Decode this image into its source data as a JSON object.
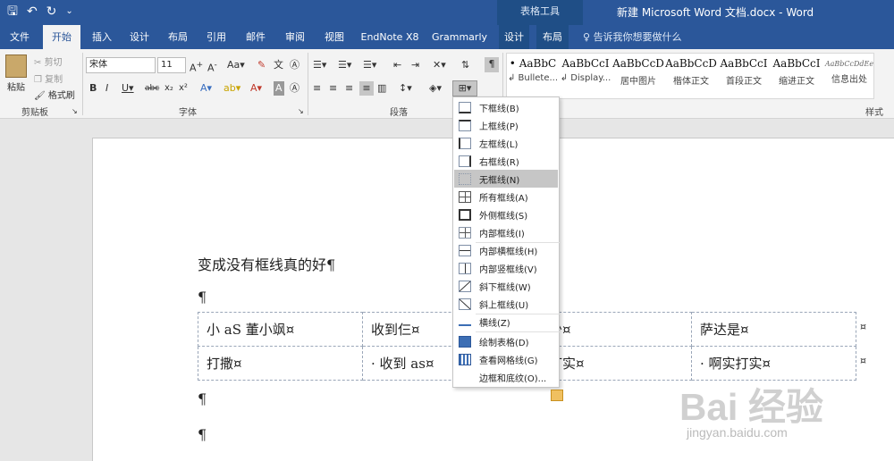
{
  "window": {
    "title": "新建 Microsoft Word 文档.docx - Word",
    "context_tab_group": "表格工具"
  },
  "qat": {
    "save_icon": "save-icon",
    "undo_icon": "undo-icon",
    "redo_icon": "redo-icon",
    "customize_icon": "customize-icon"
  },
  "tabs": [
    {
      "label": "文件"
    },
    {
      "label": "开始"
    },
    {
      "label": "插入"
    },
    {
      "label": "设计"
    },
    {
      "label": "布局"
    },
    {
      "label": "引用"
    },
    {
      "label": "邮件"
    },
    {
      "label": "审阅"
    },
    {
      "label": "视图"
    },
    {
      "label": "EndNote X8"
    },
    {
      "label": "Grammarly"
    },
    {
      "label": "设计"
    },
    {
      "label": "布局"
    }
  ],
  "tellme": "告诉我你想要做什么",
  "ribbon": {
    "clipboard": {
      "paste": "粘贴",
      "cut": "剪切",
      "copy": "复制",
      "format_painter": "格式刷",
      "label": "剪贴板"
    },
    "font": {
      "name": "宋体",
      "size": "11",
      "label": "字体"
    },
    "paragraph": {
      "label": "段落"
    },
    "styles": {
      "label": "样式",
      "items": [
        {
          "sample": "• AaBbC",
          "name": "↲ Bullete..."
        },
        {
          "sample": "AaBbCcI",
          "name": "↲ Display..."
        },
        {
          "sample": "AaBbCcD",
          "name": "居中图片"
        },
        {
          "sample": "AaBbCcD",
          "name": "楷体正文"
        },
        {
          "sample": "AaBbCcI",
          "name": "首段正文"
        },
        {
          "sample": "AaBbCcI",
          "name": "缩进正文"
        },
        {
          "sample": "AaBbCcDdEe",
          "name": "信息出处"
        }
      ]
    }
  },
  "document": {
    "heading": "变成没有框线真的好¶",
    "pilcrow": "¶",
    "table": [
      [
        "小 aS 董小飒¤",
        "收到仨¤",
        "多少¤",
        "萨达是¤"
      ],
      [
        "打撒¤",
        "· 收到 as¤",
        "实打实¤",
        "· 啊实打实¤"
      ]
    ],
    "row_end": "¤"
  },
  "border_menu": {
    "items": [
      {
        "label": "下框线(B)",
        "icon": "bottom-border-icon"
      },
      {
        "label": "上框线(P)",
        "icon": "top-border-icon"
      },
      {
        "label": "左框线(L)",
        "icon": "left-border-icon"
      },
      {
        "label": "右框线(R)",
        "icon": "right-border-icon"
      },
      {
        "label": "无框线(N)",
        "icon": "no-border-icon"
      },
      {
        "label": "所有框线(A)",
        "icon": "all-borders-icon"
      },
      {
        "label": "外侧框线(S)",
        "icon": "outside-borders-icon"
      },
      {
        "label": "内部框线(I)",
        "icon": "inside-borders-icon"
      },
      {
        "label": "内部横框线(H)",
        "icon": "inside-horizontal-border-icon"
      },
      {
        "label": "内部竖框线(V)",
        "icon": "inside-vertical-border-icon"
      },
      {
        "label": "斜下框线(W)",
        "icon": "diagonal-down-border-icon"
      },
      {
        "label": "斜上框线(U)",
        "icon": "diagonal-up-border-icon"
      },
      {
        "label": "横线(Z)",
        "icon": "horizontal-line-icon"
      },
      {
        "label": "绘制表格(D)",
        "icon": "draw-table-icon"
      },
      {
        "label": "查看网格线(G)",
        "icon": "view-gridlines-icon"
      },
      {
        "label": "边框和底纹(O)...",
        "icon": "borders-shading-icon"
      }
    ],
    "highlighted": "无框线(N)"
  },
  "watermark": {
    "logo": "Bai 经验",
    "url": "jingyan.baidu.com"
  },
  "colors": {
    "titlebar": "#2b579a",
    "ribbon": "#f3f3f3",
    "highlight": "#c6c6c6"
  }
}
